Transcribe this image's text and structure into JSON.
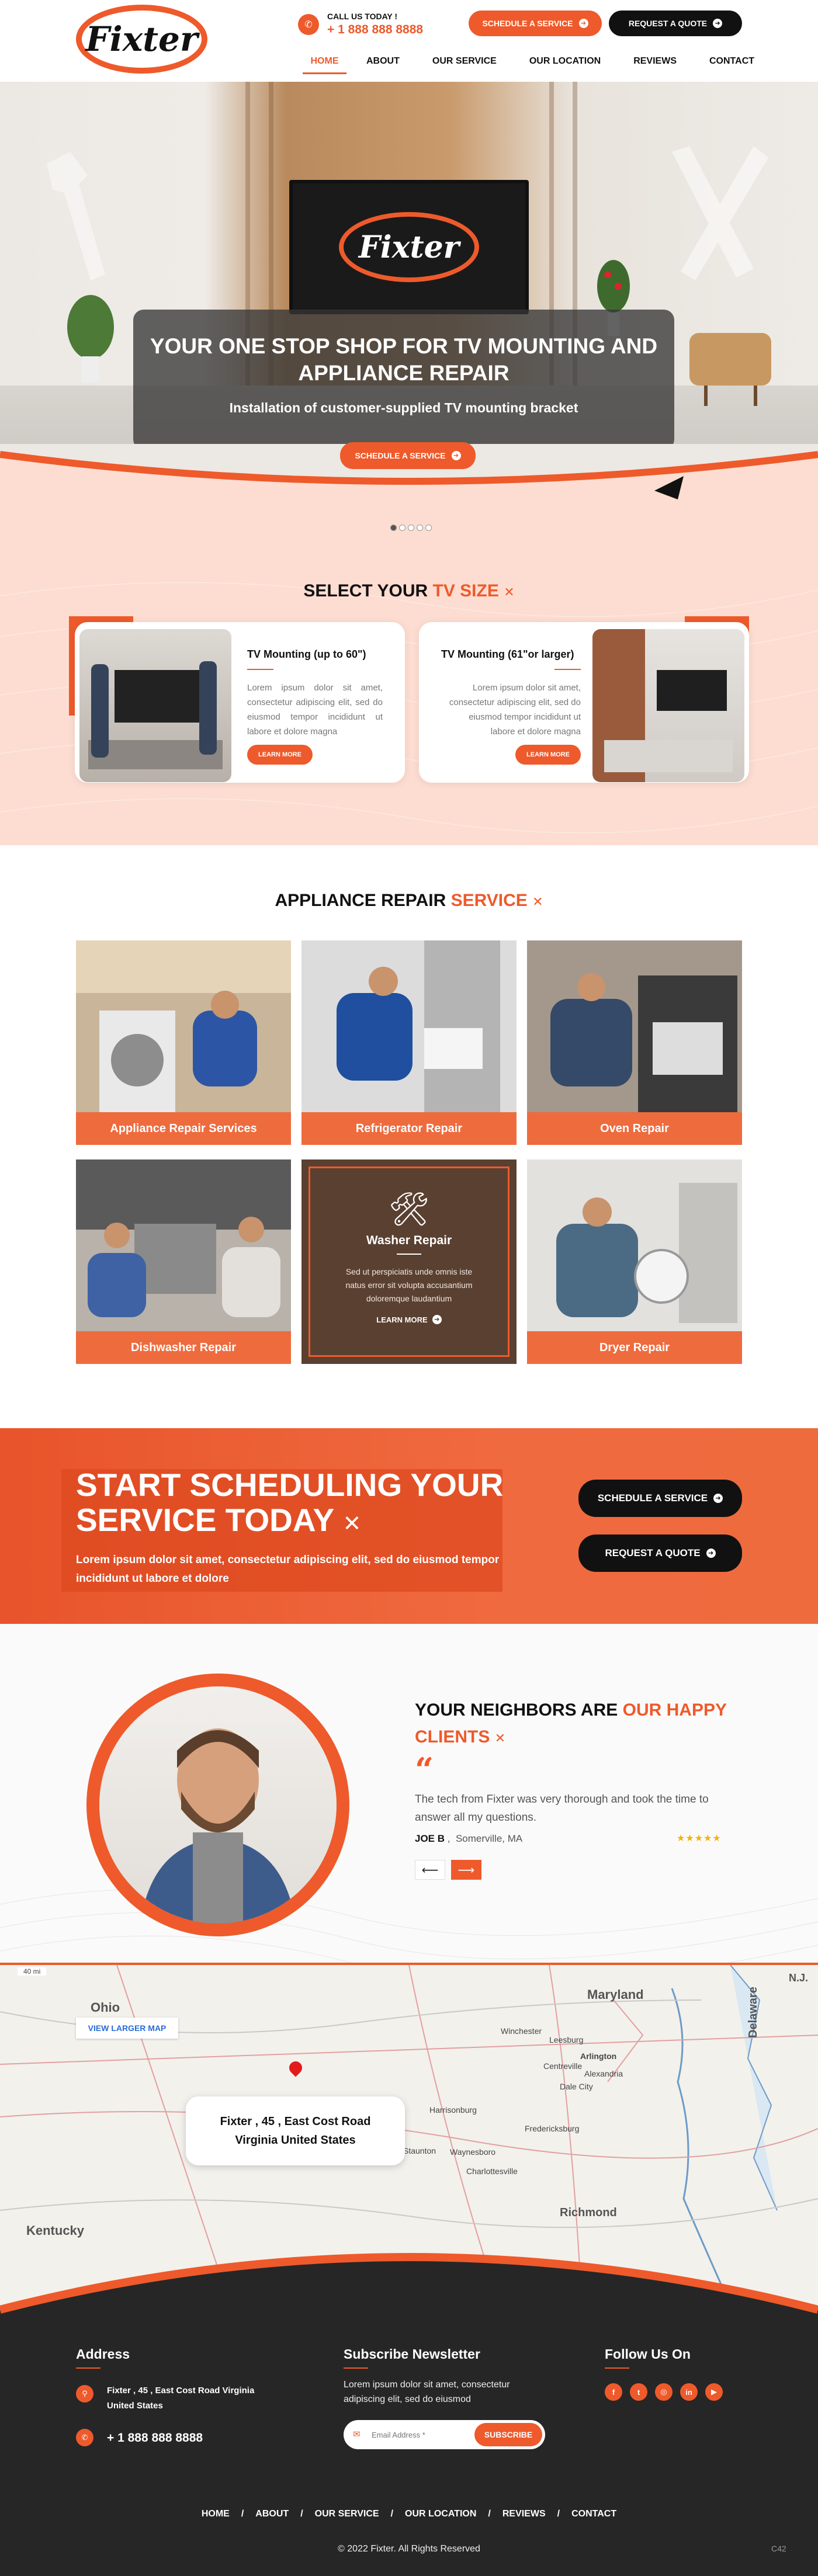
{
  "brand": {
    "name": "Fixter",
    "accent": "#ee5a2b",
    "dark": "#111111"
  },
  "header": {
    "call_label": "CALL US TODAY !",
    "phone": "+ 1 888 888 8888",
    "schedule_btn": "SCHEDULE A SERVICE",
    "quote_btn": "REQUEST A QUOTE",
    "nav": [
      "HOME",
      "ABOUT",
      "OUR SERVICE",
      "OUR LOCATION",
      "REVIEWS",
      "CONTACT"
    ]
  },
  "hero": {
    "title": "YOUR ONE STOP SHOP FOR TV MOUNTING AND APPLIANCE REPAIR",
    "subtitle": "Installation of customer-supplied TV mounting bracket",
    "button": "SCHEDULE A SERVICE",
    "slides": 5,
    "active_slide": 1
  },
  "tv_size": {
    "heading_plain": "SELECT YOUR",
    "heading_accent": "TV SIZE",
    "cards": [
      {
        "title": "TV Mounting (up to 60\")",
        "text": "Lorem ipsum dolor sit amet, consectetur adipiscing elit, sed do eiusmod tempor incididunt ut labore et dolore magna",
        "button": "LEARN MORE"
      },
      {
        "title": "TV Mounting (61\"or larger)",
        "text": "Lorem ipsum dolor sit amet, consectetur adipiscing elit, sed do eiusmod tempor incididunt ut labore et dolore magna",
        "button": "LEARN MORE"
      }
    ]
  },
  "appliance": {
    "heading_plain": "APPLIANCE REPAIR",
    "heading_accent": "SERVICE",
    "tiles": [
      {
        "label": "Appliance Repair Services"
      },
      {
        "label": "Refrigerator Repair"
      },
      {
        "label": "Oven Repair"
      },
      {
        "label": "Dishwasher Repair"
      },
      {
        "label": "Washer Repair",
        "text": "Sed ut perspiciatis unde omnis iste natus error sit volupta accusantium doloremque laudantium",
        "link": "LEARN MORE"
      },
      {
        "label": "Dryer Repair"
      }
    ]
  },
  "cta": {
    "title": "START SCHEDULING YOUR SERVICE TODAY",
    "text": "Lorem ipsum dolor sit amet, consectetur adipiscing elit, sed do eiusmod tempor incididunt ut labore et dolore",
    "schedule_btn": "SCHEDULE A SERVICE",
    "quote_btn": "REQUEST A QUOTE"
  },
  "testimonial": {
    "heading_plain": "YOUR NEIGHBORS ARE",
    "heading_accent": "OUR HAPPY CLIENTS",
    "quote": "The tech from Fixter was very thorough and took the time to answer all my questions.",
    "name": "JOE B",
    "location": "Somerville, MA",
    "rating": 5
  },
  "map": {
    "view_larger": "VIEW LARGER MAP",
    "scale": "40 mi",
    "address": "Fixter , 45 , East Cost Road Virginia United States",
    "states": [
      "Ohio",
      "Maryland",
      "Kentucky",
      "Delaware",
      "N.J."
    ],
    "cities": [
      "Winchester",
      "Leesburg",
      "Arlington",
      "Centreville",
      "Alexandria",
      "Dale City",
      "Harrisonburg",
      "Fredericksburg",
      "Staunton",
      "Waynesboro",
      "Charlottesville",
      "Richmond"
    ]
  },
  "footer": {
    "address_head": "Address",
    "address": "Fixter , 45 , East Cost Road Virginia United States",
    "phone": "+ 1 888 888 8888",
    "newsletter_head": "Subscribe Newsletter",
    "newsletter_text": "Lorem ipsum dolor sit amet, consectetur adipiscing elit, sed do eiusmod",
    "email_placeholder": "Email Address *",
    "subscribe": "SUBSCRIBE",
    "follow_head": "Follow Us On",
    "social_icons": [
      "facebook-icon",
      "twitter-icon",
      "instagram-icon",
      "linkedin-icon",
      "youtube-icon"
    ],
    "nav": [
      "HOME",
      "ABOUT",
      "OUR SERVICE",
      "OUR LOCATION",
      "REVIEWS",
      "CONTACT"
    ],
    "copyright": "© 2022 Fixter. All Rights Reserved",
    "version": "C42"
  }
}
